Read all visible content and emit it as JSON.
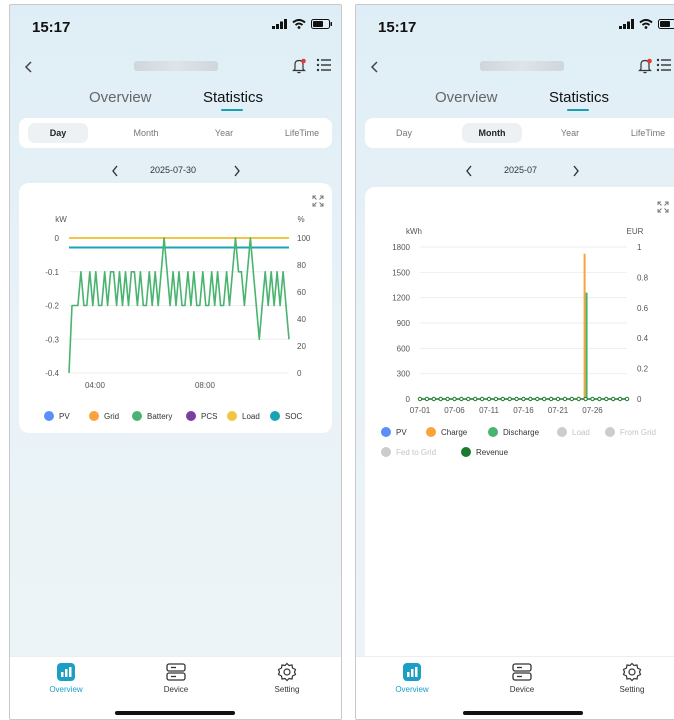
{
  "status_time": "15:17",
  "top_tabs": [
    "Overview",
    "Statistics"
  ],
  "period_tabs": [
    "Day",
    "Month",
    "Year",
    "LifeTime"
  ],
  "colors": {
    "accent": "#18a0b0",
    "pv": "#5b8ff9",
    "grid": "#f7a43a",
    "battery": "#49b46f",
    "pcs": "#7b3fa0",
    "load": "#f4c542",
    "soc": "#1aa3b8",
    "revenue": "#1a7a2e",
    "dim": "#cccccc"
  },
  "icons": {
    "back": "chevron-left-icon",
    "bell": "bell-icon",
    "menu": "list-icon",
    "expand": "expand-icon",
    "overview": "chart-icon",
    "device": "device-icon",
    "setting": "gear-icon"
  },
  "bottom_nav": [
    "Overview",
    "Device",
    "Setting"
  ],
  "day_view": {
    "active_tab": "Day",
    "date": "2025-07-30",
    "chart_data": {
      "type": "line",
      "y_left_label": "kW",
      "y_right_label": "%",
      "y_left_ticks": [
        "0",
        "-0.1",
        "-0.2",
        "-0.3",
        "-0.4"
      ],
      "y_right_ticks": [
        "100",
        "80",
        "60",
        "40",
        "20",
        "0"
      ],
      "x_ticks": [
        "04:00",
        "08:00"
      ],
      "ylim_left": [
        -0.4,
        0
      ],
      "ylim_right": [
        0,
        100
      ],
      "series": [
        {
          "name": "Load",
          "axis": "left",
          "values_const": 0
        },
        {
          "name": "SOC",
          "axis": "right",
          "values_const": 93
        },
        {
          "name": "Battery",
          "axis": "left",
          "values": [
            -0.4,
            -0.2,
            -0.2,
            -0.2,
            -0.1,
            -0.2,
            -0.2,
            -0.1,
            -0.2,
            -0.1,
            -0.2,
            -0.2,
            -0.1,
            -0.2,
            -0.1,
            -0.1,
            -0.2,
            -0.1,
            -0.2,
            -0.1,
            -0.2,
            -0.1,
            -0.1,
            -0.2,
            -0.1,
            -0.2,
            -0.2,
            -0.1,
            -0.2,
            -0.1,
            -0.2,
            -0.1,
            0,
            -0.1,
            -0.2,
            -0.1,
            -0.2,
            -0.1,
            -0.2,
            -0.2,
            -0.1,
            -0.2,
            -0.1,
            -0.2,
            -0.2,
            -0.1,
            -0.2,
            -0.2,
            -0.1,
            -0.2,
            -0.1,
            -0.2,
            -0.2,
            -0.1,
            -0.2,
            -0.1,
            0,
            -0.1,
            -0.1,
            -0.2,
            -0.1,
            0,
            -0.1,
            -0.2,
            -0.3,
            -0.2,
            -0.1,
            -0.2,
            -0.1,
            -0.2,
            -0.1,
            -0.2,
            -0.1,
            -0.2,
            -0.3
          ]
        }
      ]
    },
    "legend": [
      {
        "name": "PV",
        "color": "#5b8ff9"
      },
      {
        "name": "Grid",
        "color": "#f7a43a"
      },
      {
        "name": "Battery",
        "color": "#49b46f"
      },
      {
        "name": "PCS",
        "color": "#7b3fa0"
      },
      {
        "name": "Load",
        "color": "#f4c542"
      },
      {
        "name": "SOC",
        "color": "#1aa3b8"
      }
    ]
  },
  "month_view": {
    "active_tab": "Month",
    "date": "2025-07",
    "chart_data": {
      "type": "bar",
      "y_left_label": "kWh",
      "y_right_label": "EUR",
      "y_left_ticks": [
        "1800",
        "1500",
        "1200",
        "900",
        "600",
        "300",
        "0"
      ],
      "y_right_ticks": [
        "1",
        "0.8",
        "0.6",
        "0.4",
        "0.2",
        "0"
      ],
      "x_ticks": [
        "07-01",
        "07-06",
        "07-11",
        "07-16",
        "07-21",
        "07-26"
      ],
      "ylim_left": [
        0,
        1800
      ],
      "ylim_right": [
        0,
        1
      ],
      "days": 31,
      "series": [
        {
          "name": "Charge",
          "day": 25,
          "value": 1720
        },
        {
          "name": "Discharge",
          "day": 25,
          "value": 1260
        },
        {
          "name": "Revenue",
          "values_const": 0
        }
      ]
    },
    "legend": [
      {
        "name": "PV",
        "color": "#5b8ff9",
        "dim": false
      },
      {
        "name": "Charge",
        "color": "#f7a43a",
        "dim": false
      },
      {
        "name": "Discharge",
        "color": "#49b46f",
        "dim": false
      },
      {
        "name": "Load",
        "color": "#cccccc",
        "dim": true
      },
      {
        "name": "From Grid",
        "color": "#cccccc",
        "dim": true
      },
      {
        "name": "Fed to Grid",
        "color": "#cccccc",
        "dim": true
      },
      {
        "name": "Revenue",
        "color": "#1a7a2e",
        "dim": false
      }
    ]
  }
}
